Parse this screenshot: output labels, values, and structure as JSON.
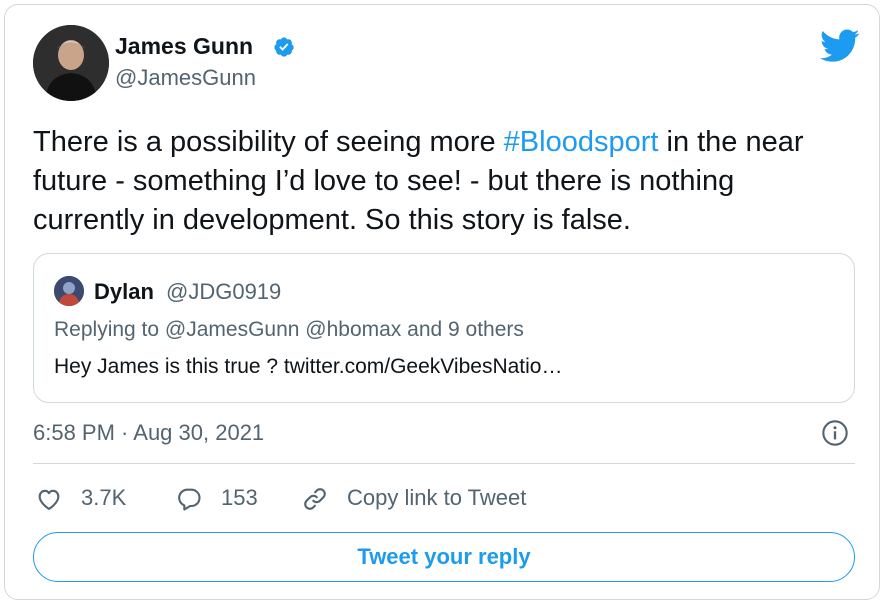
{
  "tweet": {
    "author_name": "James Gunn",
    "author_handle": "@JamesGunn",
    "text_before": "There is a possibility of seeing more ",
    "hashtag": "#Bloodsport",
    "text_after": " in the near future - something I’d love to see! - but there is nothing currently in development. So this story is false.",
    "timestamp": "6:58 PM · Aug 30, 2021",
    "verified": true
  },
  "quote": {
    "author_name": "Dylan",
    "author_handle": "@JDG0919",
    "replying_to": "Replying to @JamesGunn @hbomax and 9 others",
    "text": "Hey James is this true ? twitter.com/GeekVibesNatio…"
  },
  "actions": {
    "likes": "3.7K",
    "replies": "153",
    "copy_link": "Copy link to Tweet"
  },
  "reply_button_label": "Tweet your reply",
  "colors": {
    "accent": "#1d9bf0",
    "secondary_text": "#536471",
    "primary_text": "#0f1419",
    "border": "#cfd9de"
  },
  "icons": [
    "verified-badge-icon",
    "twitter-bird-icon",
    "info-icon",
    "heart-icon",
    "reply-bubble-icon",
    "link-icon"
  ]
}
